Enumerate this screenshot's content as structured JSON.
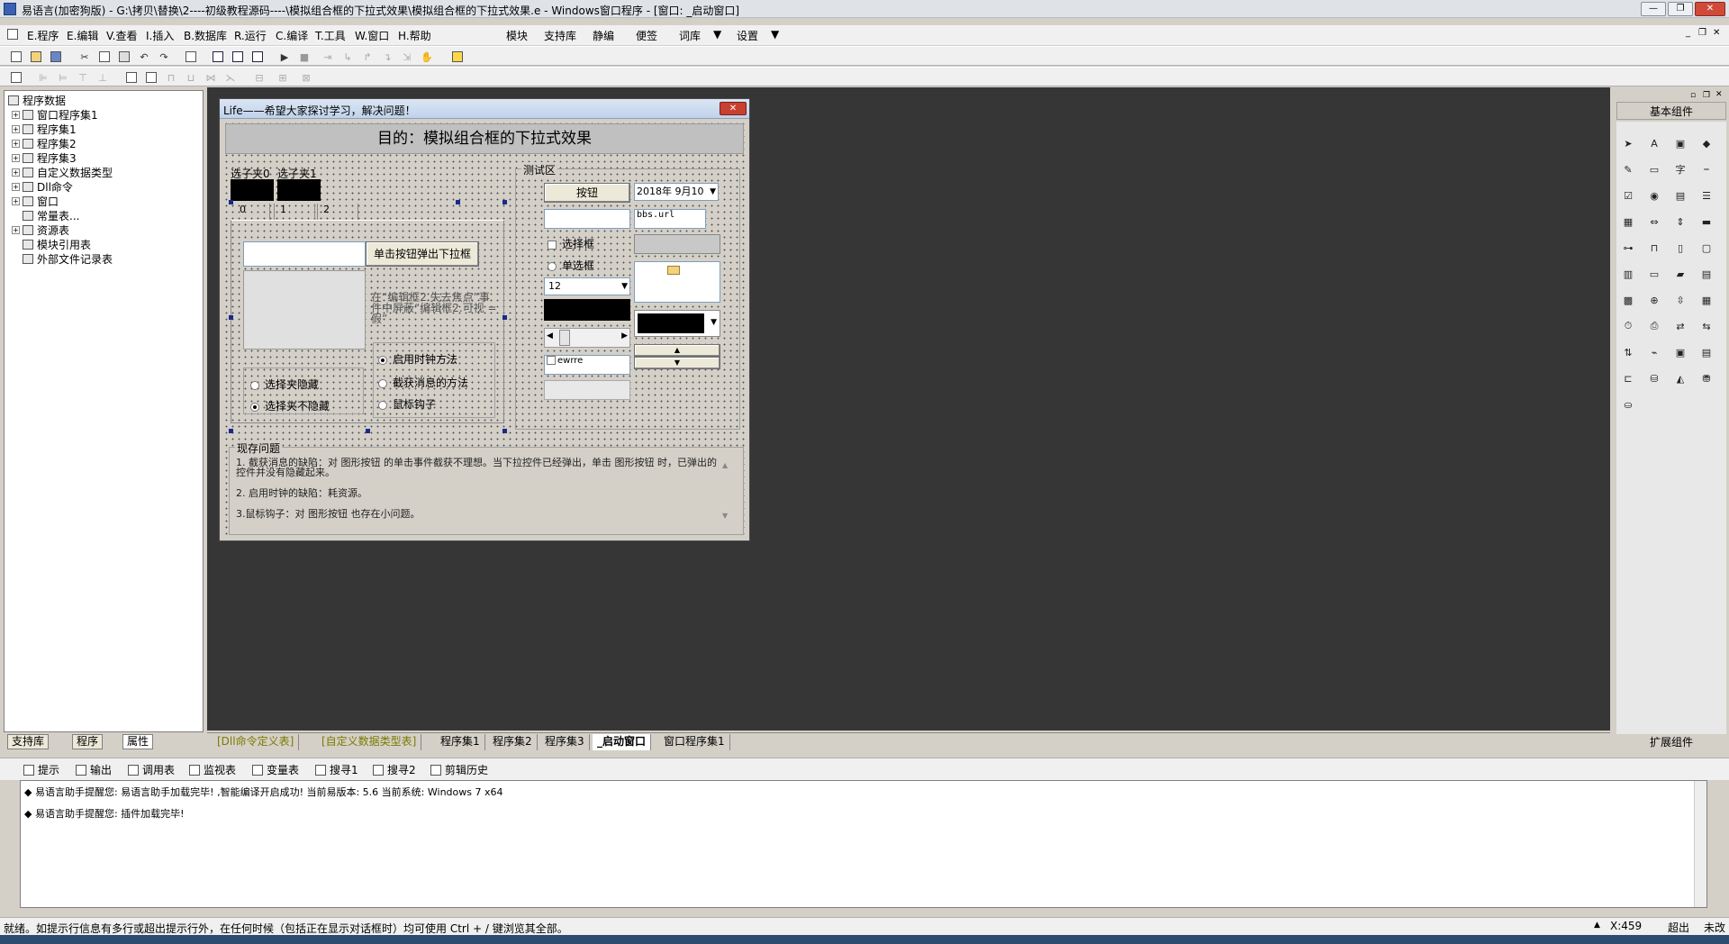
{
  "window": {
    "title": "易语言(加密狗版) - G:\\拷贝\\替换\\2----初级教程源码----\\模拟组合框的下拉式效果\\模拟组合框的下拉式效果.e - Windows窗口程序 - [窗口: _启动窗口]",
    "min_label": "—",
    "restore_label": "❐",
    "close_label": "✕"
  },
  "menu": {
    "items": [
      "E.程序",
      "E.编辑",
      "V.查看",
      "I.插入",
      "B.数据库",
      "R.运行",
      "C.编译",
      "T.工具",
      "W.窗口",
      "H.帮助"
    ],
    "right_items": [
      "模块",
      "支持库",
      "静编",
      "便签",
      "词库",
      "设置"
    ]
  },
  "tree": {
    "root": "程序数据",
    "items": [
      "窗口程序集1",
      "程序集1",
      "程序集2",
      "程序集3",
      "自定义数据类型",
      "Dll命令",
      "窗口",
      "常量表...",
      "资源表",
      "模块引用表",
      "外部文件记录表"
    ]
  },
  "left_tabs": [
    "支持库",
    "程序",
    "属性"
  ],
  "form": {
    "title": "Life——希望大家探讨学习，解决问题！",
    "close_label": "✕",
    "header": "目的：模拟组合框的下拉式效果",
    "tab_labels": [
      "选子夹0",
      "选子夹1"
    ],
    "tab_numbers": [
      "0",
      "1",
      "2"
    ],
    "dropdown_button": "单击按钮弹出下拉框",
    "hint_text": "在“编辑框2.失去焦点”事件中屏蔽“编辑框2.可视 = 假”",
    "radio_hide": "选择夹隐藏",
    "radio_nohide": "选择夹不隐藏",
    "method_timer": "启用时钟方法",
    "method_msg": "截获消息的方法",
    "method_hook": "鼠标钩子",
    "test_group": "测试区",
    "test_button": "按钮",
    "checkbox": "选择框",
    "radio_single": "单选框",
    "combo_value": "12",
    "date_value": "2018年 9月10",
    "list_value": "bbs.url",
    "list_check": "ewrre",
    "problems_group": "现存问题",
    "problems": [
      "1. 截获消息的缺陷：对 图形按钮 的单击事件截获不理想。当下拉控件已经弹出，单击 图形按钮 时，已弹出的控件并没有隐藏起来。",
      "2. 启用时钟的缺陷：耗资源。",
      "3.鼠标钩子：对 图形按钮 也存在小问题。"
    ]
  },
  "right_panel": {
    "title": "基本组件",
    "footer": "扩展组件"
  },
  "bottom_tabs": [
    "[Dll命令定义表]",
    "[自定义数据类型表]",
    "程序集1",
    "程序集2",
    "程序集3",
    "_启动窗口",
    "窗口程序集1"
  ],
  "output_tabs": [
    "提示",
    "输出",
    "调用表",
    "监视表",
    "变量表",
    "搜寻1",
    "搜寻2",
    "剪辑历史"
  ],
  "messages": [
    "易语言助手提醒您: 易语言助手加载完毕! ,智能编译开启成功! 当前易版本: 5.6 当前系统: Windows 7 x64",
    "易语言助手提醒您: 插件加载完毕!"
  ],
  "status": {
    "text": "就绪。如提示行信息有多行或超出提示行外，在任何时候（包括正在显示对话框时）均可使用 Ctrl + / 键浏览其全部。",
    "coords": "X:459",
    "mode1": "超出",
    "mode2": "未改"
  }
}
